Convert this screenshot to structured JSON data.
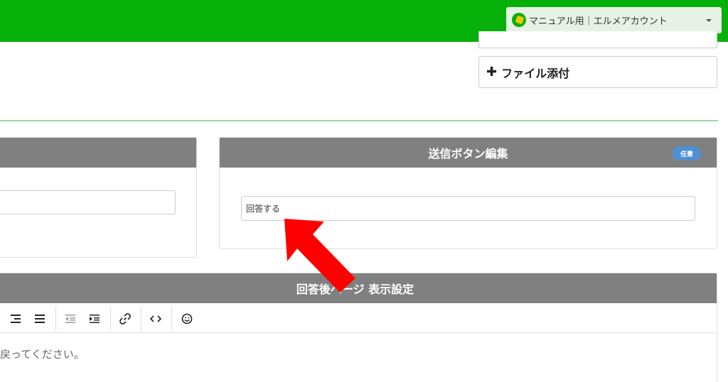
{
  "header": {
    "account_label": "マニュアル用｜エルメアカウント",
    "brand_color": "#06b10a"
  },
  "attachments": {
    "file_button_label": "ファイル添付",
    "file_button_icon": "plus-icon"
  },
  "submit_panel": {
    "title": "送信ボタン編集",
    "badge": "任意",
    "input_value": "回答する"
  },
  "after_page_panel": {
    "title": "回答後ページ 表示設定",
    "toolbar": {
      "align_right": "align-right-icon",
      "justify": "justify-icon",
      "outdent": "outdent-icon",
      "indent": "indent-icon",
      "link": "link-icon",
      "code": "code-icon",
      "emoji": "smile-icon"
    },
    "content_text": "戻ってください。"
  },
  "annotation": {
    "arrow_color": "#ff0000",
    "arrow_icon": "red-arrow-icon"
  }
}
